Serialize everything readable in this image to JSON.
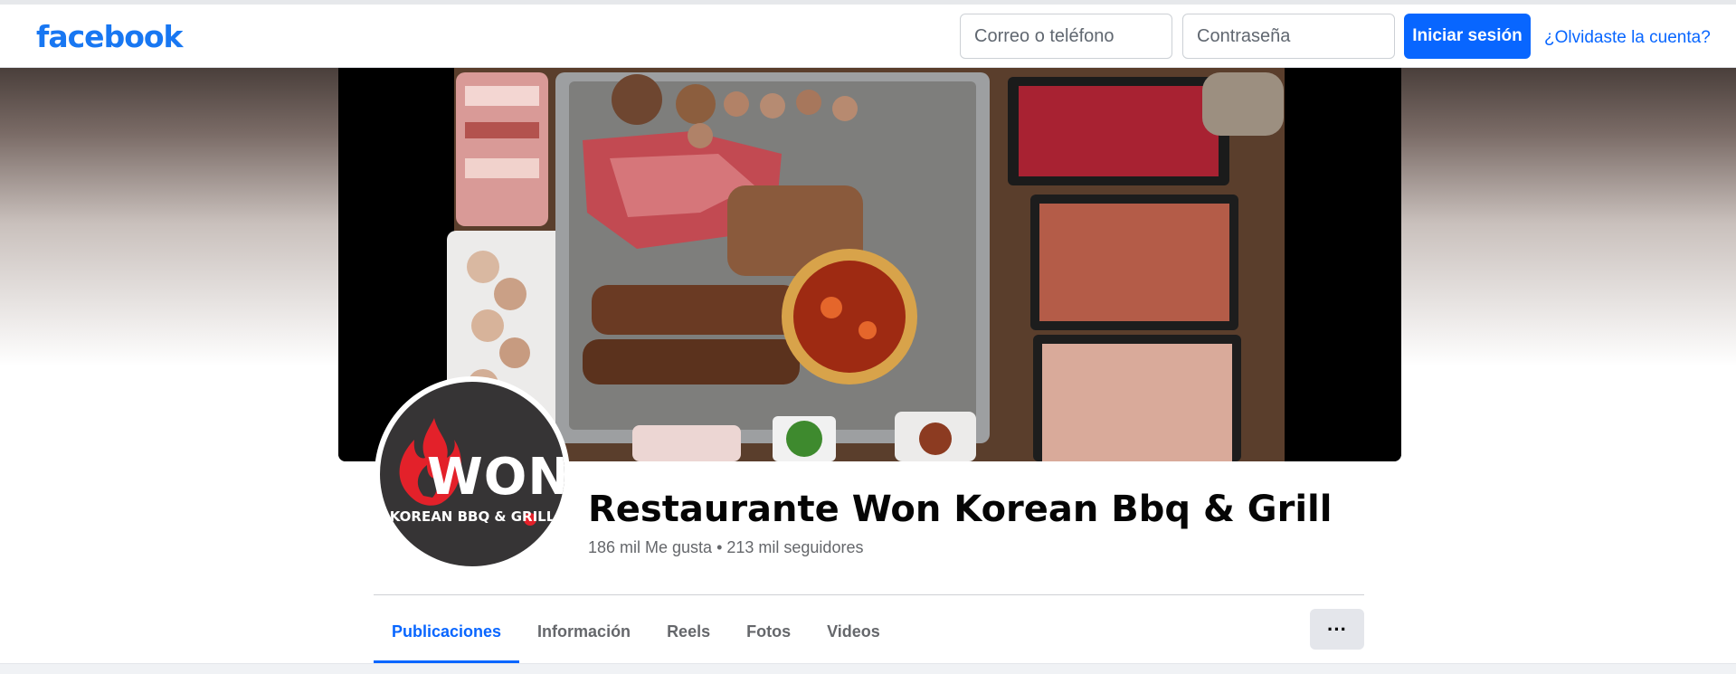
{
  "brand": {
    "logo_text": "facebook",
    "accent_color": "#0866ff"
  },
  "login": {
    "email_placeholder": "Correo o teléfono",
    "password_placeholder": "Contraseña",
    "login_button": "Iniciar sesión",
    "forgot_link": "¿Olvidaste la cuenta?"
  },
  "profile": {
    "name": "Restaurante Won Korean Bbq & Grill",
    "stats": "186 mil Me gusta • 213 mil seguidores",
    "avatar_word": "WON",
    "avatar_tagline": "KOREAN BBQ & GRILL",
    "cover_image": "korean-bbq-grill-food-photo"
  },
  "tabs": [
    {
      "label": "Publicaciones",
      "active": true
    },
    {
      "label": "Información",
      "active": false
    },
    {
      "label": "Reels",
      "active": false
    },
    {
      "label": "Fotos",
      "active": false
    },
    {
      "label": "Videos",
      "active": false
    }
  ],
  "more_button": "···"
}
